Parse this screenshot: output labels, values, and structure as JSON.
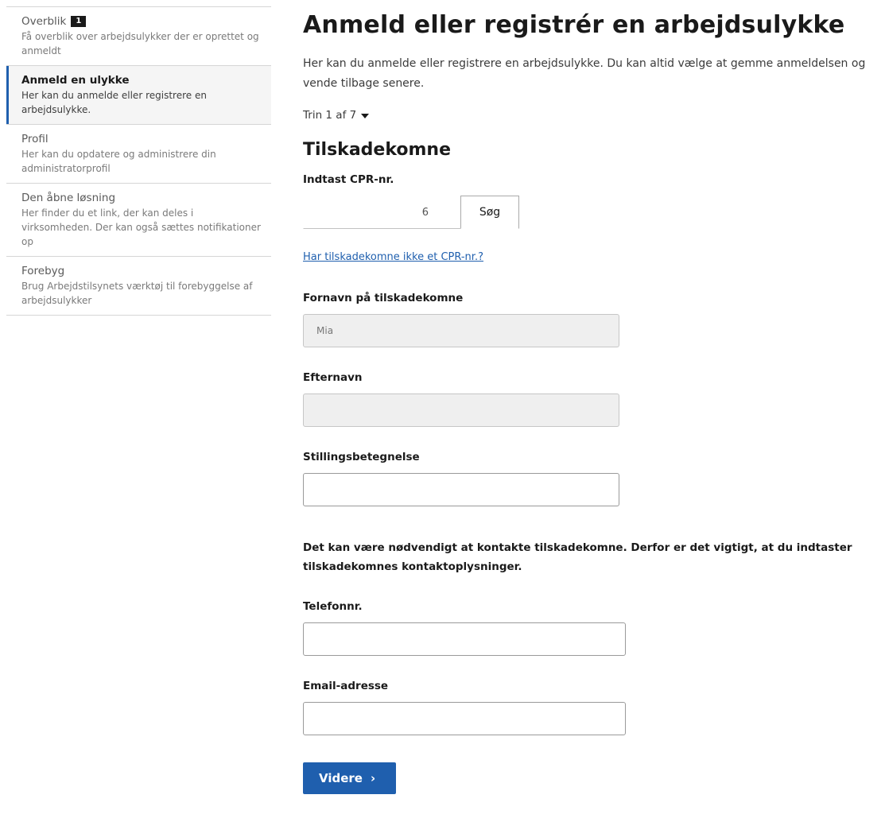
{
  "sidebar": {
    "items": [
      {
        "title": "Overblik",
        "badge": "1",
        "desc": "Få overblik over arbejdsulykker der er oprettet og anmeldt"
      },
      {
        "title": "Anmeld en ulykke",
        "desc": "Her kan du anmelde eller registrere en arbejdsulykke."
      },
      {
        "title": "Profil",
        "desc": "Her kan du opdatere og administrere din administratorprofil"
      },
      {
        "title": "Den åbne løsning",
        "desc": "Her finder du et link, der kan deles i virksomheden. Der kan også sættes notifikationer op"
      },
      {
        "title": "Forebyg",
        "desc": "Brug Arbejdstilsynets værktøj til forebyggelse af arbejdsulykker"
      }
    ]
  },
  "main": {
    "title": "Anmeld eller registrér en arbejdsulykke",
    "intro": "Her kan du anmelde eller registrere en arbejdsulykke. Du kan altid vælge at gemme anmeldelsen og vende tilbage senere.",
    "step": "Trin 1 af 7",
    "section_title": "Tilskadekomne",
    "cpr": {
      "label": "Indtast CPR-nr.",
      "value": "6",
      "button": "Søg"
    },
    "no_cpr_link": "Har tilskadekomne ikke et CPR-nr.?",
    "firstname": {
      "label": "Fornavn på tilskadekomne",
      "value": "Mia"
    },
    "lastname": {
      "label": "Efternavn",
      "value": ""
    },
    "jobtitle": {
      "label": "Stillingsbetegnelse",
      "value": ""
    },
    "contact_note": "Det kan være nødvendigt at kontakte tilskadekomne. Derfor er det vigtigt, at du indtaster tilskadekomnes kontaktoplysninger.",
    "phone": {
      "label": "Telefonnr.",
      "value": ""
    },
    "email": {
      "label": "Email-adresse",
      "value": ""
    },
    "next_button": "Videre",
    "next_icon": "›"
  },
  "colors": {
    "accent": "#1f5fae",
    "text": "#1a1a1a",
    "badge_bg": "#1a1a1a"
  }
}
